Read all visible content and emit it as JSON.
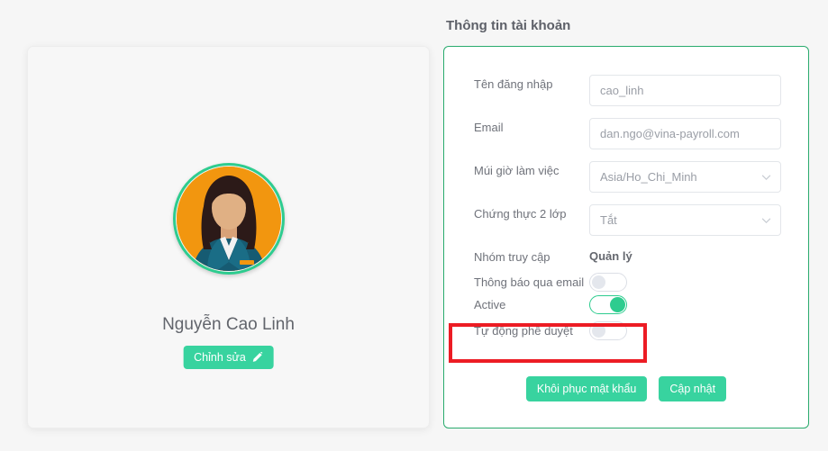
{
  "page": {
    "background_color": "#f6f6f6",
    "accent_color": "#38d39f",
    "panel_border_color": "#2aab6e",
    "highlight_color": "#ec1c24"
  },
  "profile": {
    "name": "Nguyễn Cao Linh",
    "edit_label": "Chỉnh sửa",
    "edit_icon": "pencil-icon",
    "avatar_icon": "user-avatar-illustration",
    "avatar_colors": {
      "background": "#f2960f",
      "hair": "#2c1a18",
      "skin": "#e0b084",
      "jacket": "#165b72",
      "shirt": "#f2f2f2",
      "badge": "#f2960f",
      "ring": "#2ecc8f"
    }
  },
  "account": {
    "title": "Thông tin tài khoản",
    "fields": [
      {
        "label": "Tên đăng nhập",
        "value": "cao_linh",
        "type": "text"
      },
      {
        "label": "Email",
        "value": "dan.ngo@vina-payroll.com",
        "type": "text"
      },
      {
        "label": "Múi giờ làm việc",
        "value": "Asia/Ho_Chi_Minh",
        "type": "select"
      },
      {
        "label": "Chứng thực 2 lớp",
        "value": "Tắt",
        "type": "select"
      }
    ],
    "access_group": {
      "label": "Nhóm truy cập",
      "value": "Quản lý"
    },
    "toggles": [
      {
        "label": "Thông báo qua email",
        "state": "off",
        "highlighted": false
      },
      {
        "label": "Active",
        "state": "on",
        "highlighted": false
      },
      {
        "label": "Tự động phê duyệt",
        "state": "off",
        "highlighted": true
      }
    ],
    "buttons": {
      "reset_password": "Khôi phục mật khẩu",
      "update": "Cập nhật"
    }
  }
}
